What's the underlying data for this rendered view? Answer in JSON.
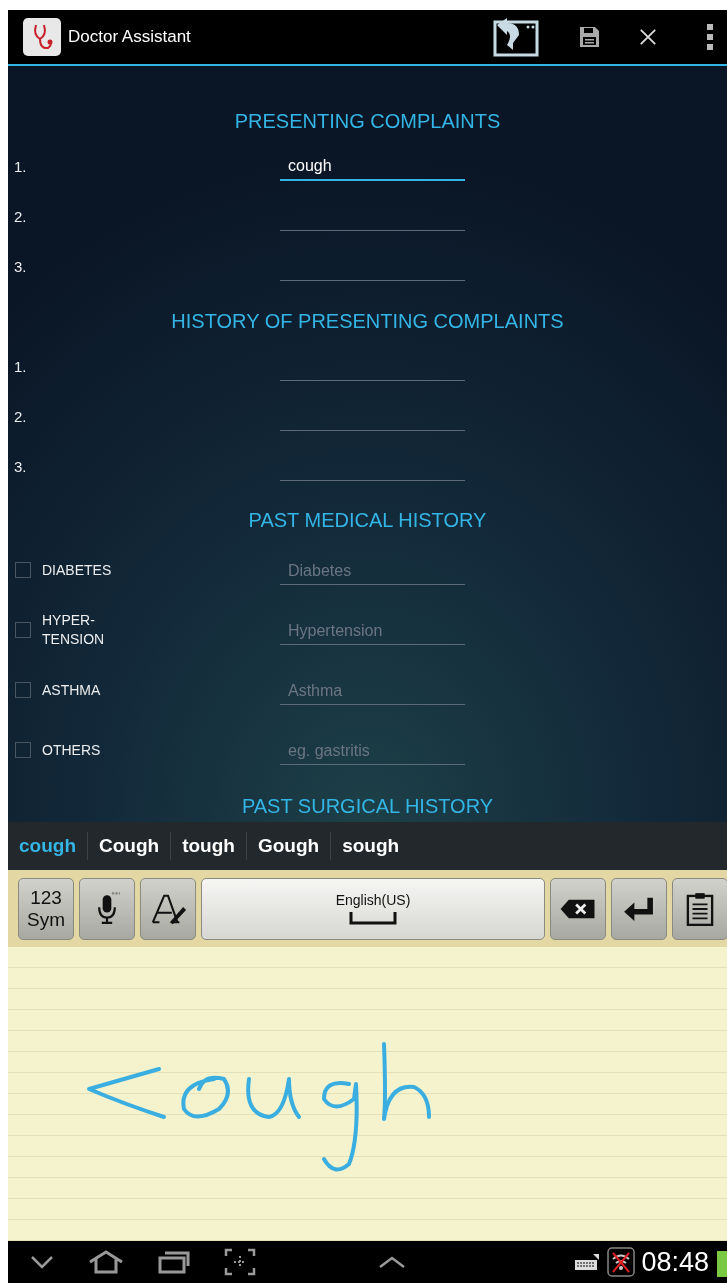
{
  "app_bar": {
    "title": "Doctor Assistant"
  },
  "sections": [
    {
      "heading": "PRESENTING COMPLAINTS",
      "kind": "numbered",
      "rows": [
        {
          "label": "1.",
          "value": "cough",
          "focused": true
        },
        {
          "label": "2.",
          "value": "",
          "focused": false
        },
        {
          "label": "3.",
          "value": "",
          "focused": false
        }
      ]
    },
    {
      "heading": "HISTORY OF PRESENTING COMPLAINTS",
      "kind": "numbered",
      "rows": [
        {
          "label": "1.",
          "focused": false
        },
        {
          "label": "2.",
          "focused": false
        },
        {
          "label": "3.",
          "focused": false
        }
      ]
    },
    {
      "heading": "PAST MEDICAL HISTORY",
      "kind": "checklist",
      "rows": [
        {
          "label": "DIABETES",
          "checked": false,
          "placeholder": "Diabetes"
        },
        {
          "label": "HYPER-\nTENSION",
          "checked": false,
          "placeholder": "Hypertension"
        },
        {
          "label": "ASTHMA",
          "checked": false,
          "placeholder": "Asthma"
        },
        {
          "label": "OTHERS",
          "checked": false,
          "placeholder": "eg. gastritis"
        }
      ]
    },
    {
      "heading": "PAST SURGICAL HISTORY"
    }
  ],
  "suggestions": [
    {
      "word": "cough",
      "selected": true
    },
    {
      "word": "Cough",
      "selected": false
    },
    {
      "word": "tough",
      "selected": false
    },
    {
      "word": "Gough",
      "selected": false
    },
    {
      "word": "sough",
      "selected": false
    }
  ],
  "keys": [
    {
      "kind": "symbols",
      "lines": [
        "123",
        "Sym"
      ]
    },
    {
      "kind": "mic"
    },
    {
      "kind": "handwriting"
    },
    {
      "kind": "space",
      "label": "English(US)"
    },
    {
      "kind": "backspace"
    },
    {
      "kind": "enter"
    },
    {
      "kind": "clipboard"
    }
  ],
  "status_bar": {
    "time": "08:48"
  }
}
